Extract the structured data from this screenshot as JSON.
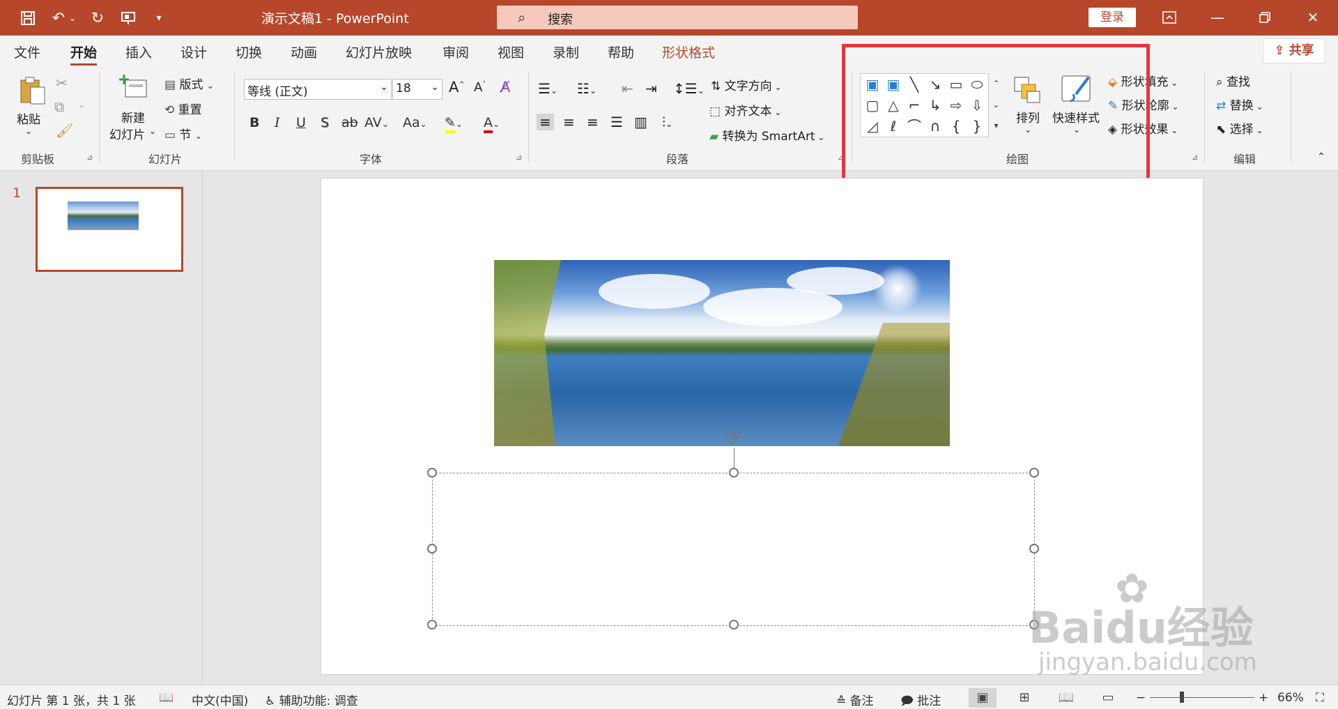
{
  "titlebar": {
    "title": "演示文稿1  -  PowerPoint",
    "search_placeholder": "搜索",
    "login_label": "登录",
    "accent_color": "#b7472a"
  },
  "tabs": [
    "文件",
    "开始",
    "插入",
    "设计",
    "切换",
    "动画",
    "幻灯片放映",
    "审阅",
    "视图",
    "录制",
    "帮助",
    "形状格式"
  ],
  "active_tab": "开始",
  "share_label": "共享",
  "ribbon": {
    "clipboard": {
      "paste": "粘贴",
      "group": "剪贴板"
    },
    "slides": {
      "new_slide_line1": "新建",
      "new_slide_line2": "幻灯片",
      "layout": "版式",
      "reset": "重置",
      "section": "节",
      "group": "幻灯片"
    },
    "font": {
      "font_name": "等线 (正文)",
      "font_size": "18",
      "bold": "B",
      "italic": "I",
      "underline": "U",
      "shadow": "S",
      "strike": "ab",
      "spacing": "AV",
      "case": "Aa",
      "group": "字体"
    },
    "paragraph": {
      "text_direction": "文字方向",
      "align_text": "对齐文本",
      "smartart": "转换为 SmartArt",
      "group": "段落"
    },
    "drawing": {
      "arrange": "排列",
      "quick_styles": "快速样式",
      "shape_fill": "形状填充",
      "shape_outline": "形状轮廓",
      "shape_effects": "形状效果",
      "group": "绘图"
    },
    "editing": {
      "find": "查找",
      "replace": "替换",
      "select": "选择",
      "group": "编辑"
    }
  },
  "thumbnails": [
    {
      "number": "1"
    }
  ],
  "statusbar": {
    "slide_info": "幻灯片 第 1 张，共 1 张",
    "language": "中文(中国)",
    "accessibility": "辅助功能: 调查",
    "notes": "备注",
    "comments": "批注",
    "zoom": "66%"
  },
  "watermark": {
    "main": "Baidu经验",
    "sub": "jingyan.baidu.com"
  }
}
